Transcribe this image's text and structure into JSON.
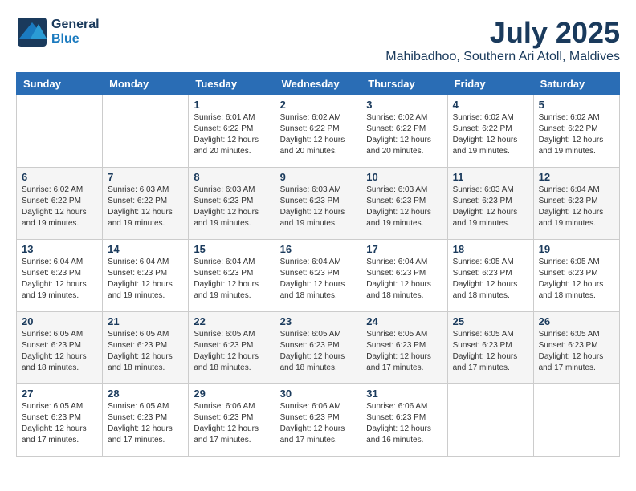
{
  "header": {
    "logo": {
      "text_general": "General",
      "text_blue": "Blue"
    },
    "title": "July 2025",
    "location": "Mahibadhoo, Southern Ari Atoll, Maldives"
  },
  "calendar": {
    "days_of_week": [
      "Sunday",
      "Monday",
      "Tuesday",
      "Wednesday",
      "Thursday",
      "Friday",
      "Saturday"
    ],
    "weeks": [
      [
        {
          "day": "",
          "info": ""
        },
        {
          "day": "",
          "info": ""
        },
        {
          "day": "1",
          "info": "Sunrise: 6:01 AM\nSunset: 6:22 PM\nDaylight: 12 hours and 20 minutes."
        },
        {
          "day": "2",
          "info": "Sunrise: 6:02 AM\nSunset: 6:22 PM\nDaylight: 12 hours and 20 minutes."
        },
        {
          "day": "3",
          "info": "Sunrise: 6:02 AM\nSunset: 6:22 PM\nDaylight: 12 hours and 20 minutes."
        },
        {
          "day": "4",
          "info": "Sunrise: 6:02 AM\nSunset: 6:22 PM\nDaylight: 12 hours and 19 minutes."
        },
        {
          "day": "5",
          "info": "Sunrise: 6:02 AM\nSunset: 6:22 PM\nDaylight: 12 hours and 19 minutes."
        }
      ],
      [
        {
          "day": "6",
          "info": "Sunrise: 6:02 AM\nSunset: 6:22 PM\nDaylight: 12 hours and 19 minutes."
        },
        {
          "day": "7",
          "info": "Sunrise: 6:03 AM\nSunset: 6:22 PM\nDaylight: 12 hours and 19 minutes."
        },
        {
          "day": "8",
          "info": "Sunrise: 6:03 AM\nSunset: 6:23 PM\nDaylight: 12 hours and 19 minutes."
        },
        {
          "day": "9",
          "info": "Sunrise: 6:03 AM\nSunset: 6:23 PM\nDaylight: 12 hours and 19 minutes."
        },
        {
          "day": "10",
          "info": "Sunrise: 6:03 AM\nSunset: 6:23 PM\nDaylight: 12 hours and 19 minutes."
        },
        {
          "day": "11",
          "info": "Sunrise: 6:03 AM\nSunset: 6:23 PM\nDaylight: 12 hours and 19 minutes."
        },
        {
          "day": "12",
          "info": "Sunrise: 6:04 AM\nSunset: 6:23 PM\nDaylight: 12 hours and 19 minutes."
        }
      ],
      [
        {
          "day": "13",
          "info": "Sunrise: 6:04 AM\nSunset: 6:23 PM\nDaylight: 12 hours and 19 minutes."
        },
        {
          "day": "14",
          "info": "Sunrise: 6:04 AM\nSunset: 6:23 PM\nDaylight: 12 hours and 19 minutes."
        },
        {
          "day": "15",
          "info": "Sunrise: 6:04 AM\nSunset: 6:23 PM\nDaylight: 12 hours and 19 minutes."
        },
        {
          "day": "16",
          "info": "Sunrise: 6:04 AM\nSunset: 6:23 PM\nDaylight: 12 hours and 18 minutes."
        },
        {
          "day": "17",
          "info": "Sunrise: 6:04 AM\nSunset: 6:23 PM\nDaylight: 12 hours and 18 minutes."
        },
        {
          "day": "18",
          "info": "Sunrise: 6:05 AM\nSunset: 6:23 PM\nDaylight: 12 hours and 18 minutes."
        },
        {
          "day": "19",
          "info": "Sunrise: 6:05 AM\nSunset: 6:23 PM\nDaylight: 12 hours and 18 minutes."
        }
      ],
      [
        {
          "day": "20",
          "info": "Sunrise: 6:05 AM\nSunset: 6:23 PM\nDaylight: 12 hours and 18 minutes."
        },
        {
          "day": "21",
          "info": "Sunrise: 6:05 AM\nSunset: 6:23 PM\nDaylight: 12 hours and 18 minutes."
        },
        {
          "day": "22",
          "info": "Sunrise: 6:05 AM\nSunset: 6:23 PM\nDaylight: 12 hours and 18 minutes."
        },
        {
          "day": "23",
          "info": "Sunrise: 6:05 AM\nSunset: 6:23 PM\nDaylight: 12 hours and 18 minutes."
        },
        {
          "day": "24",
          "info": "Sunrise: 6:05 AM\nSunset: 6:23 PM\nDaylight: 12 hours and 17 minutes."
        },
        {
          "day": "25",
          "info": "Sunrise: 6:05 AM\nSunset: 6:23 PM\nDaylight: 12 hours and 17 minutes."
        },
        {
          "day": "26",
          "info": "Sunrise: 6:05 AM\nSunset: 6:23 PM\nDaylight: 12 hours and 17 minutes."
        }
      ],
      [
        {
          "day": "27",
          "info": "Sunrise: 6:05 AM\nSunset: 6:23 PM\nDaylight: 12 hours and 17 minutes."
        },
        {
          "day": "28",
          "info": "Sunrise: 6:05 AM\nSunset: 6:23 PM\nDaylight: 12 hours and 17 minutes."
        },
        {
          "day": "29",
          "info": "Sunrise: 6:06 AM\nSunset: 6:23 PM\nDaylight: 12 hours and 17 minutes."
        },
        {
          "day": "30",
          "info": "Sunrise: 6:06 AM\nSunset: 6:23 PM\nDaylight: 12 hours and 17 minutes."
        },
        {
          "day": "31",
          "info": "Sunrise: 6:06 AM\nSunset: 6:23 PM\nDaylight: 12 hours and 16 minutes."
        },
        {
          "day": "",
          "info": ""
        },
        {
          "day": "",
          "info": ""
        }
      ]
    ]
  }
}
